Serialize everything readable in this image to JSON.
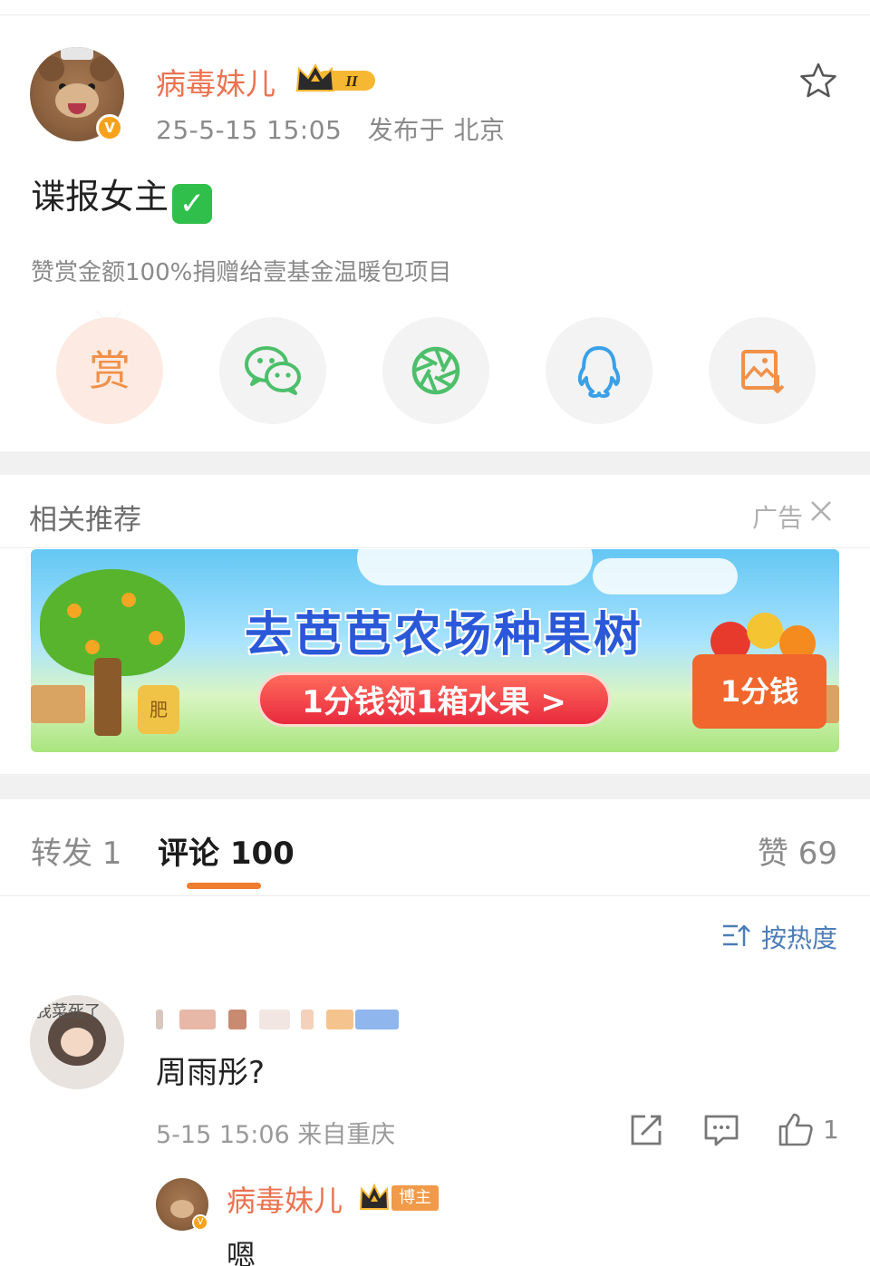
{
  "post": {
    "author": "病毒妹儿",
    "crown_level": "II",
    "verified_badge": "V",
    "timestamp": "25-5-15 15:05",
    "location": "发布于 北京",
    "content": "谍报女主",
    "content_emoji": "✓",
    "reward_note": "赞赏金额100%捐赠给壹基金温暖包项目"
  },
  "share": {
    "reward_label": "赏",
    "items": [
      "reward-icon",
      "wechat-icon",
      "moments-icon",
      "qq-icon",
      "save-image-icon"
    ]
  },
  "recommend": {
    "title": "相关推荐",
    "ad_label": "广告"
  },
  "banner": {
    "headline": "去芭芭农场种果树",
    "cta": "1分钱领1箱水果 >",
    "box_text": "1分钱",
    "jar_text": "肥"
  },
  "tabs": {
    "repost": "转发 1",
    "comment": "评论 100",
    "like": "赞 69"
  },
  "sort": {
    "label": "按热度"
  },
  "comment": {
    "avatar_text": "我菜死了",
    "text": "周雨彤?",
    "meta": "5-15 15:06 来自重庆",
    "like_count": "1"
  },
  "reply": {
    "author": "病毒妹儿",
    "tag": "博主",
    "text": "嗯"
  },
  "colors": {
    "username": "#eb7350",
    "accent": "#f07c2f",
    "link": "#4d7db8"
  }
}
